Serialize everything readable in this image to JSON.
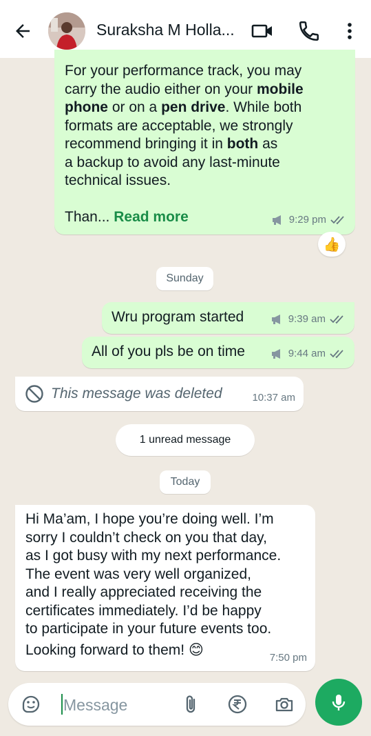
{
  "header": {
    "contact_name": "Suraksha M Holla..."
  },
  "messages": {
    "m1": {
      "line1": "For your performance track, you may",
      "line2a": "carry the audio either on your ",
      "line2b": "mobile",
      "line3a": "phone",
      "line3b": " or on a ",
      "line3c": "pen drive",
      "line3d": ". While both",
      "line4": "formats are acceptable, we strongly",
      "line5a": "recommend bringing it in ",
      "line5b": "both",
      "line5c": " as",
      "line6": "a backup to avoid any last-minute",
      "line7": "technical issues.",
      "truncated": "Than...",
      "read_more": "Read more",
      "time": "9:29 pm",
      "reaction": "👍"
    },
    "day1": "Sunday",
    "m2": {
      "text": "Wru  program started",
      "time": "9:39 am"
    },
    "m3": {
      "text": "All of you pls be on time",
      "time": "9:44 am"
    },
    "m4": {
      "text": "This message was deleted",
      "time": "10:37 am"
    },
    "unread": "1 unread message",
    "day2": "Today",
    "m5": {
      "lines": [
        "Hi Ma’am, I hope you’re doing well. I’m",
        "sorry I couldn’t check on you that day,",
        "as I got busy with my next performance.",
        "The event was very well organized,",
        "and I really appreciated receiving the",
        "certificates immediately. I’d be happy",
        "to participate in your future events too.",
        "Looking forward to them! 😊"
      ],
      "time": "7:50 pm"
    }
  },
  "input": {
    "placeholder": "Message"
  },
  "colors": {
    "outgoing_bubble": "#d9fdd3",
    "incoming_bubble": "#ffffff",
    "chat_background": "#efeae2",
    "accent_green": "#1daa61",
    "read_more": "#1a8d48"
  },
  "icons": [
    "back-arrow-icon",
    "video-call-icon",
    "phone-icon",
    "more-options-icon",
    "megaphone-icon",
    "double-check-icon",
    "deleted-icon",
    "sticker-icon",
    "attach-icon",
    "rupee-icon",
    "camera-icon",
    "mic-icon"
  ]
}
